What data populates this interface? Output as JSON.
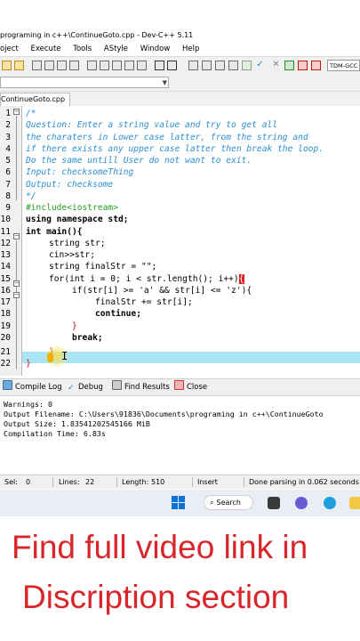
{
  "window": {
    "title": "programing in c++\\ContinueGoto.cpp - Dev-C++ 5.11"
  },
  "menu": {
    "items": [
      "oject",
      "Execute",
      "Tools",
      "AStyle",
      "Window",
      "Help"
    ]
  },
  "toolbar": {
    "compiler": "TDM-GCC"
  },
  "tabs": {
    "file": "ContinueGoto.cpp"
  },
  "editor": {
    "lines": [
      {
        "n": "1",
        "text": "/*"
      },
      {
        "n": "2",
        "text": "Question: Enter a string value and try to get all"
      },
      {
        "n": "3",
        "text": "the charaters in Lower case latter, from the string and"
      },
      {
        "n": "4",
        "text": "if there exists any upper case latter then break the loop."
      },
      {
        "n": "5",
        "text": "Do the same untill User do not want to exit."
      },
      {
        "n": "6",
        "text": "Input: checksomeThing"
      },
      {
        "n": "7",
        "text": "Output: checksome"
      },
      {
        "n": "8",
        "text": "*/"
      },
      {
        "n": "9",
        "text": "#include<iostream>"
      },
      {
        "n": "10",
        "text": "using namespace std;"
      },
      {
        "n": "11",
        "text": "int main(){"
      },
      {
        "n": "12",
        "text": "string str;"
      },
      {
        "n": "13",
        "text": "cin>>str;"
      },
      {
        "n": "14",
        "text": "string finalStr = \"\";"
      },
      {
        "n": "15",
        "text": "for(int i = 0; i < str.length(); i++){"
      },
      {
        "n": "16",
        "text": "if(str[i] >= 'a' && str[i] <= 'z'){"
      },
      {
        "n": "17",
        "text": "finalStr += str[i];"
      },
      {
        "n": "18",
        "text": "continue;"
      },
      {
        "n": "19",
        "text": "}"
      },
      {
        "n": "20",
        "text": "break;"
      },
      {
        "n": "21",
        "text": "}"
      },
      {
        "n": "22",
        "text": "}"
      }
    ]
  },
  "panel": {
    "tabs": [
      "Compile Log",
      "Debug",
      "Find Results",
      "Close"
    ],
    "log": [
      "Warnings: 0",
      "Output Filename: C:\\Users\\91836\\Documents\\programing in c++\\ContinueGoto",
      "Output Size: 1.83541202545166 MiB",
      "Compilation Time: 6.83s"
    ]
  },
  "status": {
    "sel_label": "Sel:",
    "sel_value": "0",
    "lines_label": "Lines:",
    "lines_value": "22",
    "length_label": "Length:",
    "length_value": "510",
    "mode": "Insert",
    "parse": "Done parsing in 0.062 seconds"
  },
  "taskbar": {
    "search": "Search"
  },
  "caption": {
    "line1": "Find full video link in",
    "line2": "Discription section"
  },
  "colors": {
    "comment": "#2d8fd5",
    "preprocessor": "#22a022",
    "string": "#1e3fe0",
    "current_line": "#a9e5f5",
    "caption": "#d9262b"
  }
}
